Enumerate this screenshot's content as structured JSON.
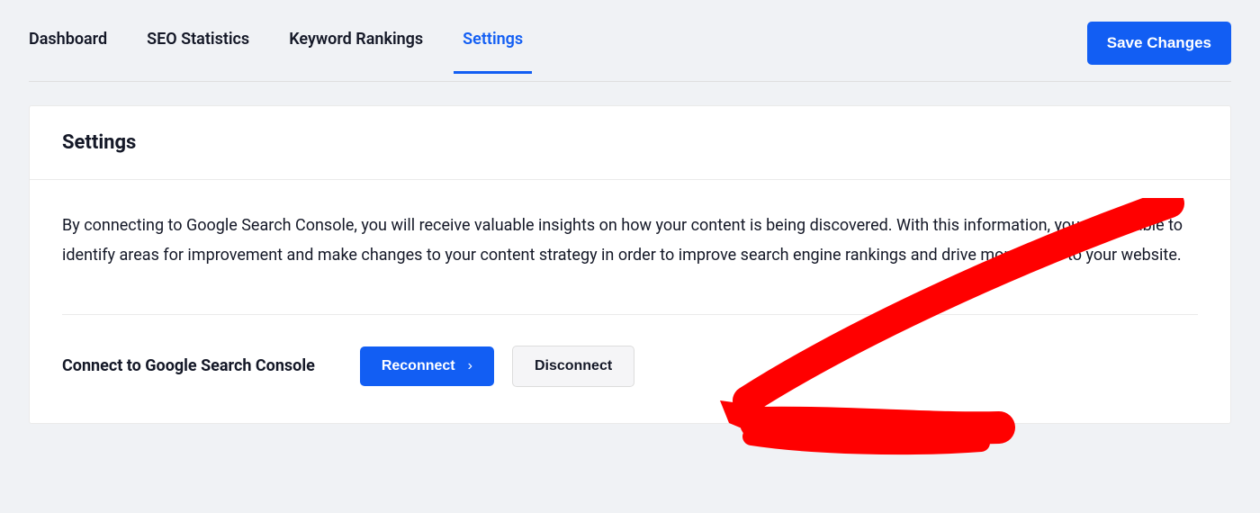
{
  "nav": {
    "tabs": [
      {
        "label": "Dashboard"
      },
      {
        "label": "SEO Statistics"
      },
      {
        "label": "Keyword Rankings"
      },
      {
        "label": "Settings"
      }
    ],
    "save_label": "Save Changes"
  },
  "card": {
    "title": "Settings",
    "description": "By connecting to Google Search Console, you will receive valuable insights on how your content is being discovered. With this information, you will be able to identify areas for improvement and make changes to your content strategy in order to improve search engine rankings and drive more traffic to your website.",
    "connect_label": "Connect to Google Search Console",
    "reconnect_label": "Reconnect",
    "disconnect_label": "Disconnect"
  },
  "colors": {
    "primary": "#125ef3",
    "annotation": "#ff0000"
  }
}
